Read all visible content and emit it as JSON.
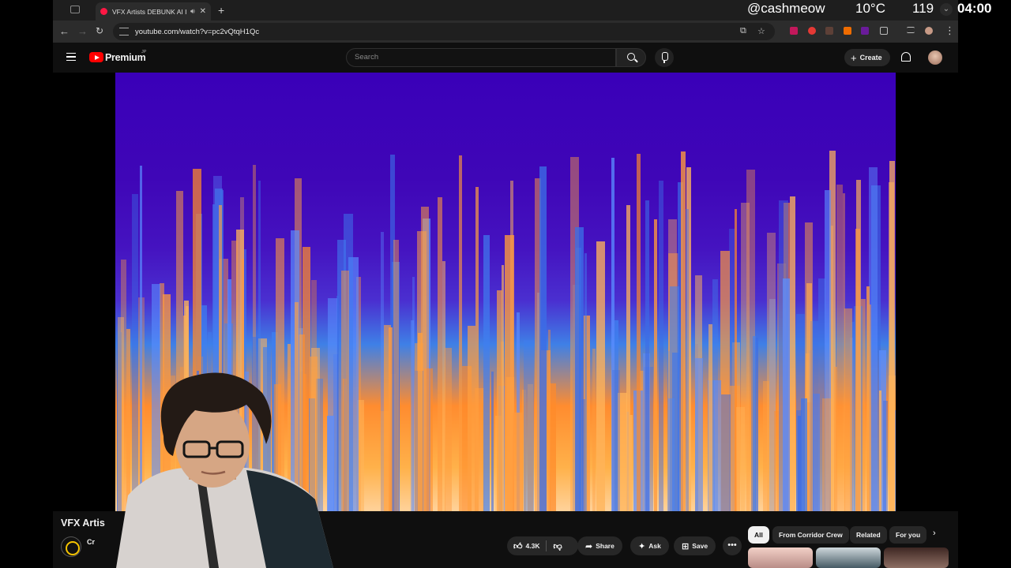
{
  "overlay": {
    "handle": "@cashmeow",
    "temperature": "10°C",
    "count": "119",
    "time": "04:00"
  },
  "browser": {
    "tab_title": "VFX Artists DEBUNK AI In",
    "url": "youtube.com/watch?v=pc2vQtqH1Qc"
  },
  "youtube": {
    "logo_text": "Premium",
    "region": "JP",
    "search_placeholder": "Search",
    "create_label": "Create"
  },
  "video": {
    "title": "VFX Artis",
    "channel": "Cr",
    "likes": "4.3K",
    "share_label": "Share",
    "ask_label": "Ask",
    "save_label": "Save"
  },
  "chips": [
    "All",
    "From Corridor Crew",
    "Related",
    "For you"
  ],
  "colors": {
    "spectrogram_low": "#3a00b8",
    "spectrogram_mid": "#3f80e6",
    "spectrogram_high": "#ff8c2f",
    "brand_red": "#ff0000"
  }
}
